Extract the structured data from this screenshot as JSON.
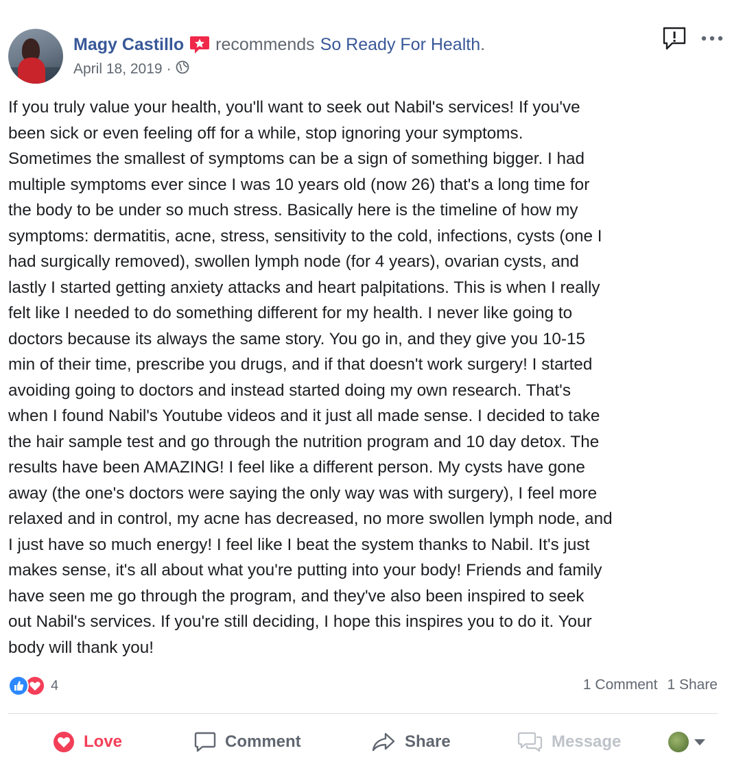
{
  "header": {
    "author": "Magy Castillo",
    "action": "recommends",
    "page": "So Ready For Health",
    "period": ".",
    "date": "April 18, 2019",
    "separator": "·"
  },
  "post_text_lines": [
    "If you truly value your health, you'll want to seek out Nabil's services! If you've",
    "been sick or even feeling off for a while, stop ignoring your symptoms.",
    "Sometimes the smallest of symptoms can be a sign of something bigger. I had",
    "multiple symptoms ever since I was 10 years old (now 26) that's a long time for",
    "the body to be under so much stress. Basically here is the timeline of how my",
    "symptoms: dermatitis, acne, stress, sensitivity to the cold, infections, cysts (one I",
    "had surgically removed), swollen lymph node (for 4 years), ovarian cysts, and",
    "lastly I started getting anxiety attacks and heart palpitations. This is when I really",
    "felt like I needed to do something different for my health. I never like going to",
    "doctors because its always the same story. You go in, and they give you 10-15",
    "min of their time, prescribe you drugs, and if that doesn't work surgery! I started",
    "avoiding going to doctors and instead started doing my own research. That's",
    "when I found Nabil's Youtube videos and it just all made sense. I decided to take",
    "the hair sample test and go through the nutrition program and 10 day detox. The",
    "results have been AMAZING! I feel like a different person. My cysts have gone",
    "away (the one's doctors were saying the only way was with surgery), I feel more",
    "relaxed and in control, my acne has decreased, no more swollen lymph node, and",
    "I just have so much energy! I feel like I beat the system thanks to Nabil. It's just",
    "makes sense, it's all about what you're putting into your body! Friends and family",
    "have seen me go through the program, and they've also been inspired to seek",
    "out Nabil's services. If you're still deciding, I hope this inspires you to do it. Your",
    "body will thank you!"
  ],
  "reactions": {
    "count": "4",
    "comments": "1 Comment",
    "shares": "1 Share"
  },
  "actions": {
    "love": "Love",
    "comment": "Comment",
    "share": "Share",
    "message": "Message"
  },
  "icons": {
    "badge": "recommendation-badge-icon",
    "privacy": "globe-icon",
    "report": "report-icon",
    "more": "more-options-icon"
  },
  "colors": {
    "link": "#385898",
    "secondary_text": "#606770",
    "love": "#f33e58",
    "like": "#2d88ff",
    "disabled": "#bec3c9"
  }
}
